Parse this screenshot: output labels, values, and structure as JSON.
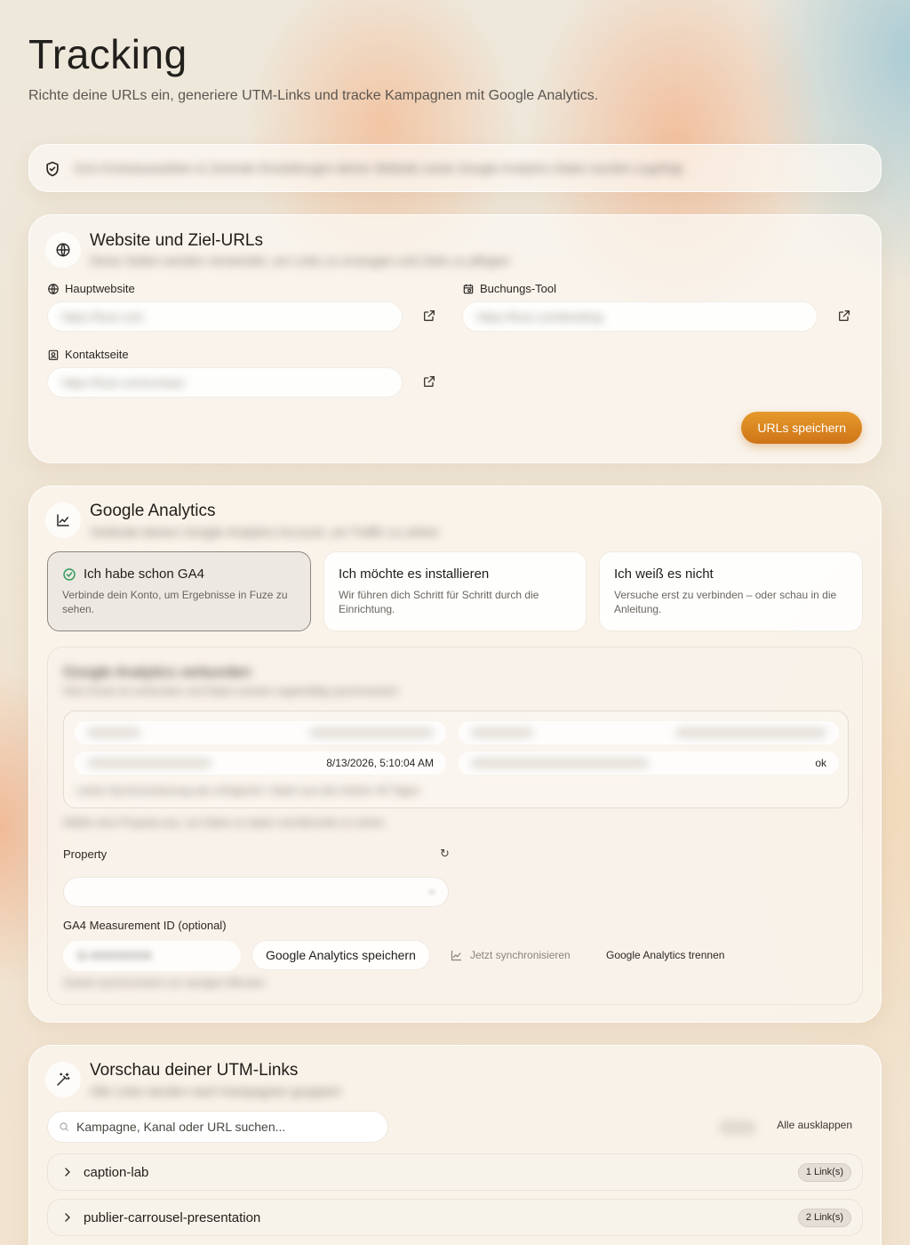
{
  "header": {
    "title": "Tracking",
    "subtitle": "Richte deine URLs ein, generiere UTM-Links und tracke Kampagnen mit Google Analytics."
  },
  "notice": {
    "icon": "shield-check-icon",
    "text": "Zum Kontoauswahlen & Zentrale Einstellungen deiner Website sowie Google Analytics Daten wurden zugefügt"
  },
  "urls_section": {
    "title": "Website und Ziel-URLs",
    "subtitle": "Diese Seiten werden verwendet, um Links zu erzeugen und Ziele zu pflegen",
    "main_site": {
      "label": "Hauptwebsite",
      "placeholder": "https://fuze.com"
    },
    "booking": {
      "label": "Buchungs-Tool",
      "placeholder": "https://fuze.com/booking"
    },
    "contact": {
      "label": "Kontaktseite",
      "placeholder": "https://fuze.com/contact"
    },
    "save_label": "URLs speichern",
    "accent": "#d98222"
  },
  "ga_section": {
    "title": "Google Analytics",
    "subtitle": "Verbinde deinen Google Analytics Account, um Traffic zu sehen",
    "choices": [
      {
        "title": "Ich habe schon GA4",
        "desc": "Verbinde dein Konto, um Ergebnisse in Fuze zu sehen."
      },
      {
        "title": "Ich möchte es installieren",
        "desc": "Wir führen dich Schritt für Schritt durch die Einrichtung."
      },
      {
        "title": "Ich weiß es nicht",
        "desc": "Versuche erst zu verbinden – oder schau in die Anleitung."
      }
    ],
    "connection": {
      "title": "Google Analytics verbunden",
      "subtitle": "Dein Konto ist verbunden und Daten werden regelmäßig synchronisiert",
      "timestamp": "8/13/2026, 5:10:04 AM",
      "status": "ok",
      "note": "Letzte Synchronisierung war erfolgreich. Daten aus den letzten 30 Tagen",
      "hint": "Wähle eine Property aus, um Daten zu laden und Berichte zu sehen"
    },
    "property_label": "Property",
    "refresh_icon": "↻",
    "measurement_label": "GA4 Measurement ID (optional)",
    "measurement_value": "G-XXXXXXXX",
    "save_label": "Google Analytics speichern",
    "sync_label": "Jetzt synchronisieren",
    "disconnect_label": "Google Analytics trennen",
    "footer_note": "Zuletzt synchronisiert vor wenigen Minuten"
  },
  "utm_section": {
    "title": "Vorschau deiner UTM-Links",
    "subtitle": "Alle Links werden nach Kampagnen gruppiert",
    "search_placeholder": "Kampagne, Kanal oder URL suchen...",
    "expand_all_label": "Alle ausklappen",
    "rows": [
      {
        "name": "caption-lab",
        "count": "1 Link(s)"
      },
      {
        "name": "publier-carrousel-presentation",
        "count": "2 Link(s)"
      }
    ]
  }
}
